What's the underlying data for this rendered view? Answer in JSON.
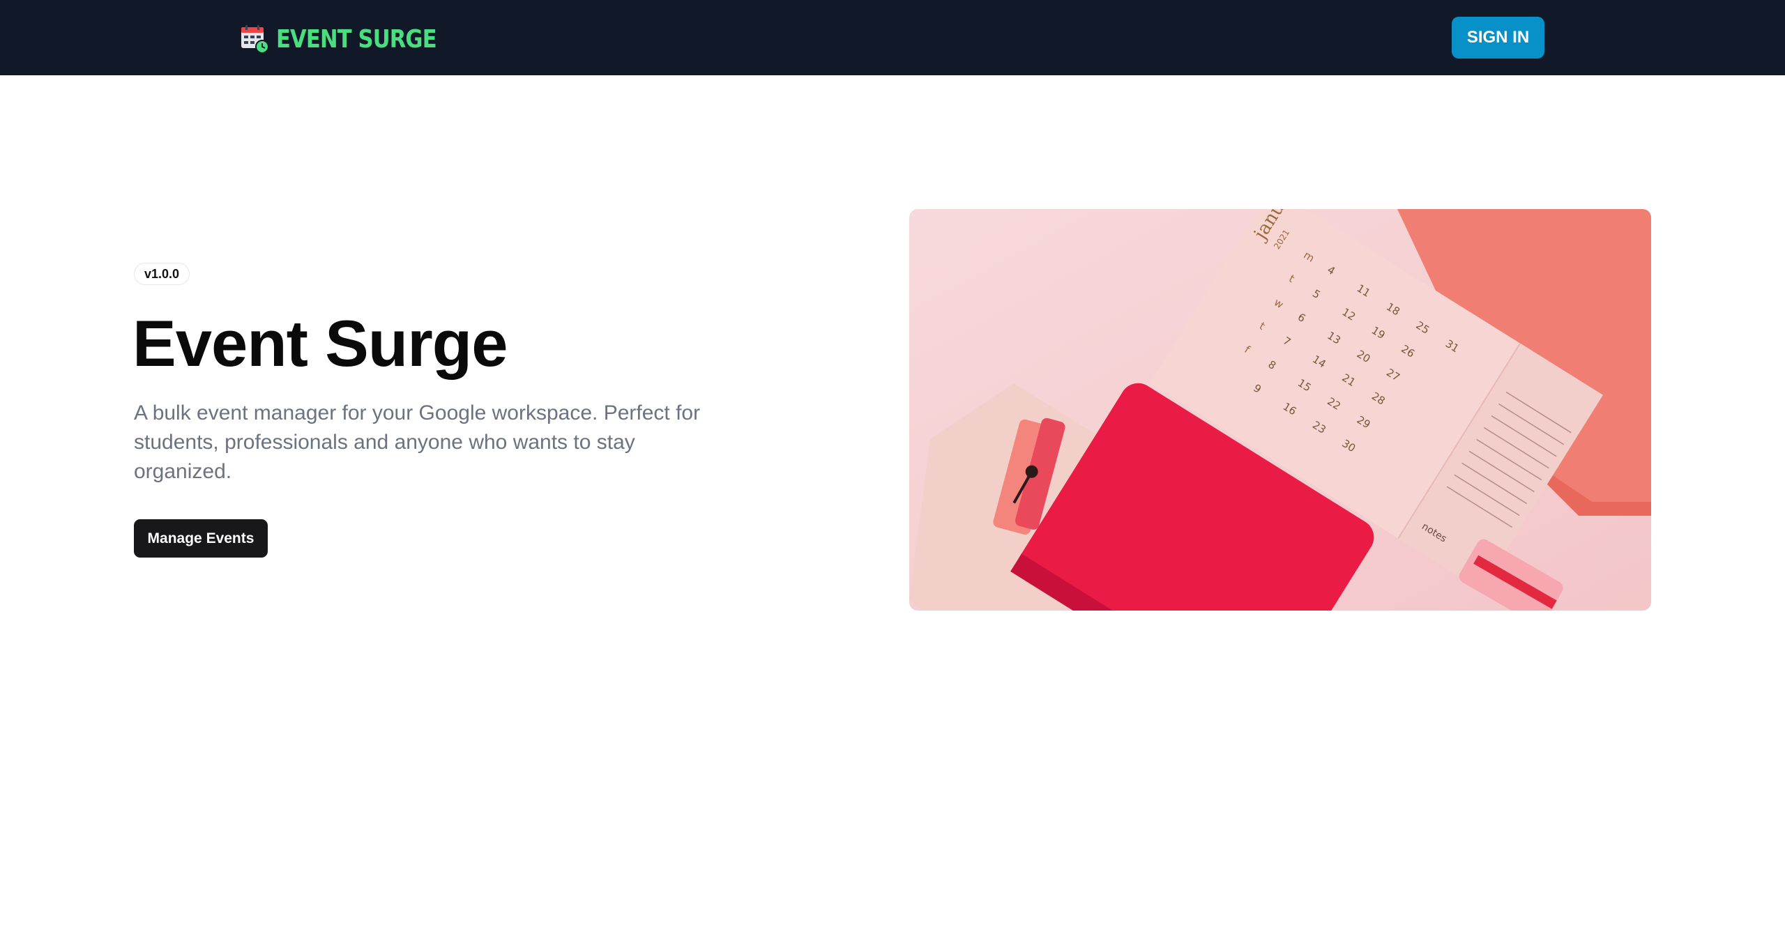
{
  "navbar": {
    "brand_name": "EVENT SURGE",
    "brand_icon": "calendar-clock-icon",
    "signin_label": "SIGN IN"
  },
  "hero": {
    "version_badge": "v1.0.0",
    "title": "Event Surge",
    "description": "A bulk event manager for your Google workspace. Perfect for students, professionals and anyone who wants to stay organized.",
    "cta_label": "Manage Events",
    "image": {
      "calendar_month": "january",
      "calendar_year": "2021",
      "weekday_labels": [
        "m",
        "t",
        "w",
        "t",
        "f"
      ],
      "calendar_days": [
        "4",
        "5",
        "6",
        "7",
        "8",
        "9",
        "11",
        "12",
        "13",
        "14",
        "15",
        "16",
        "18",
        "19",
        "20",
        "21",
        "22",
        "23",
        "25",
        "26",
        "27",
        "28",
        "29",
        "30",
        "31"
      ],
      "notes_label": "notes"
    }
  },
  "colors": {
    "navbar_bg": "#111827",
    "brand_accent": "#4ade80",
    "signin_bg": "#0891c9",
    "cta_bg": "#18181b",
    "description_text": "#6b7280"
  }
}
